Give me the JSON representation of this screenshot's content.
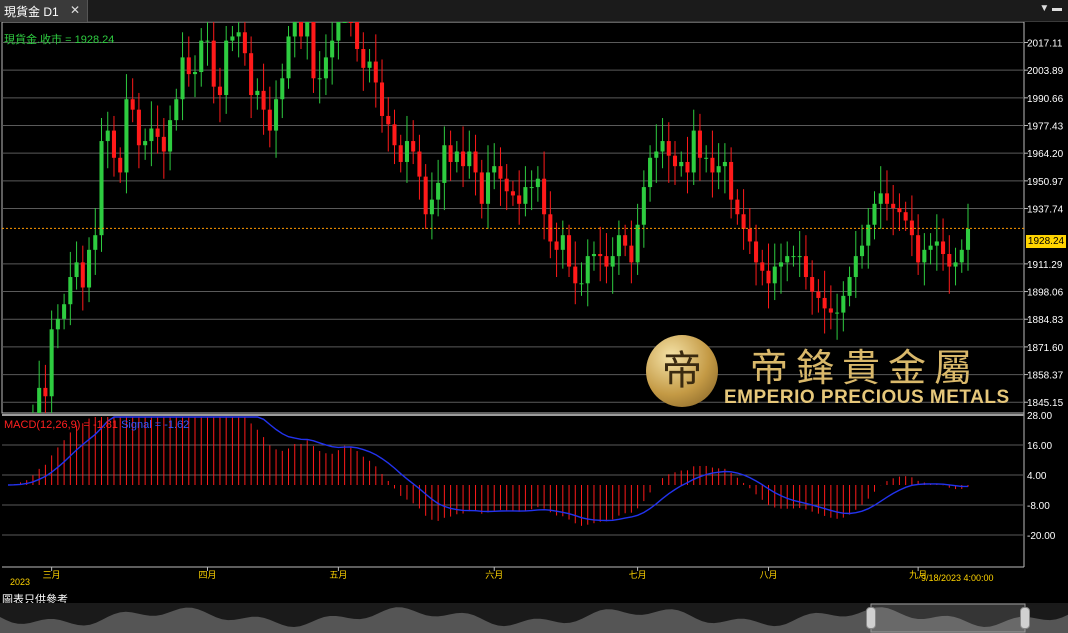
{
  "window": {
    "tab_title": "現貨金 D1",
    "tab_close": "✕",
    "controls": "▼ ▬"
  },
  "main_chart": {
    "title": "現貨金.收市 = 1928.24",
    "current_price": "1928.24",
    "price_labels": [
      "2017.11",
      "2003.89",
      "1990.66",
      "1977.43",
      "1964.20",
      "1950.97",
      "1937.74",
      "1911.29",
      "1898.06",
      "1884.83",
      "1871.60",
      "1858.37",
      "1845.15"
    ],
    "price_ticks": [
      2017.11,
      2003.89,
      1990.66,
      1977.43,
      1964.2,
      1950.97,
      1937.74,
      1911.29,
      1898.06,
      1884.83,
      1871.6,
      1858.37,
      1845.15
    ],
    "colors": {
      "up": "#2ecc40",
      "down": "#ff1a1a",
      "grid": "#5a5a5a",
      "price_line": "#ff9900"
    }
  },
  "macd": {
    "title": "MACD(12,26,9) = -1.81",
    "signal": "Signal = -1.62",
    "axis_labels": [
      "28.00",
      "16.00",
      "4.00",
      "-8.00",
      "-20.00"
    ],
    "axis_ticks": [
      28,
      16,
      4,
      -8,
      -20
    ],
    "colors": {
      "hist": "#ff1a1a",
      "signal": "#2233ee"
    }
  },
  "time_axis": {
    "year": "2023",
    "months": [
      "三月",
      "四月",
      "五月",
      "六月",
      "七月",
      "八月",
      "九月"
    ],
    "datestamp": "9/18/2023 4:00:00"
  },
  "watermark": {
    "emblem": "帝",
    "chinese": "帝鋒貴金屬",
    "english": "EMPERIO PRECIOUS METALS"
  },
  "footer": {
    "disclaimer": "圖表只供參考"
  },
  "chart_data": {
    "type": "candlestick",
    "title": "現貨金.收市 = 1928.24",
    "ylim": [
      1840,
      2025
    ],
    "closes": [
      1808,
      1812,
      1818,
      1822,
      1838,
      1852,
      1848,
      1880,
      1885,
      1892,
      1905,
      1912,
      1900,
      1918,
      1925,
      1970,
      1975,
      1962,
      1955,
      1990,
      1985,
      1968,
      1970,
      1976,
      1972,
      1965,
      1980,
      1990,
      2010,
      2002,
      2003,
      2018,
      2018,
      1996,
      1992,
      2018,
      2020,
      2022,
      2012,
      1992,
      1994,
      1985,
      1975,
      1990,
      2000,
      2020,
      2035,
      2020,
      2040,
      2000,
      2000,
      2010,
      2018,
      2040,
      2050,
      2030,
      2014,
      2005,
      2008,
      1998,
      1982,
      1978,
      1968,
      1960,
      1970,
      1965,
      1953,
      1935,
      1942,
      1950,
      1968,
      1960,
      1965,
      1958,
      1965,
      1955,
      1940,
      1955,
      1958,
      1952,
      1946,
      1944,
      1940,
      1948,
      1948,
      1952,
      1935,
      1922,
      1918,
      1925,
      1910,
      1902,
      1902,
      1915,
      1916,
      1915,
      1910,
      1915,
      1925,
      1920,
      1912,
      1930,
      1948,
      1962,
      1965,
      1970,
      1963,
      1958,
      1960,
      1955,
      1975,
      1962,
      1962,
      1955,
      1958,
      1960,
      1942,
      1935,
      1928,
      1922,
      1912,
      1908,
      1902,
      1910,
      1912,
      1915,
      1915,
      1915,
      1905,
      1898,
      1895,
      1890,
      1888,
      1888,
      1896,
      1905,
      1915,
      1920,
      1930,
      1940,
      1945,
      1940,
      1938,
      1936,
      1932,
      1925,
      1912,
      1918,
      1920,
      1922,
      1916,
      1910,
      1912,
      1918,
      1928
    ]
  }
}
